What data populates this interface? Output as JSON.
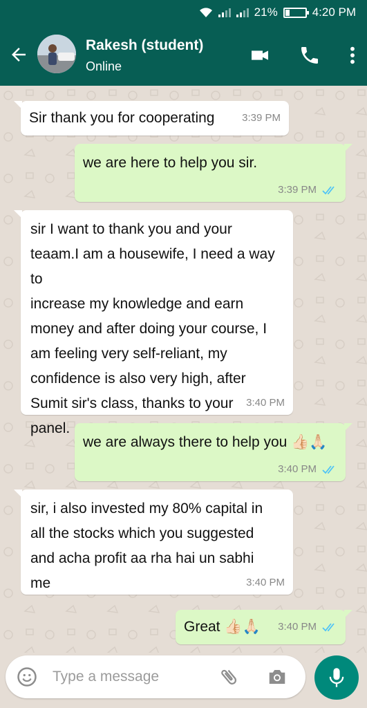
{
  "status_bar": {
    "battery_text": "21%",
    "battery_level": 0.21,
    "time": "4:20 PM"
  },
  "header": {
    "contact_name": "Rakesh (student)",
    "contact_status": "Online",
    "icons": [
      "back-arrow-icon",
      "video-call-icon",
      "phone-icon",
      "more-vert-icon"
    ]
  },
  "messages": [
    {
      "direction": "incoming",
      "text": "Sir thank you for cooperating",
      "time": "3:39 PM"
    },
    {
      "direction": "outgoing",
      "text": "we are here to help you sir.",
      "time": "3:39 PM",
      "status": "read"
    },
    {
      "direction": "incoming",
      "text": "sir I want to thank you and your\nteaam.I am a housewife, I need a way to\nincrease my knowledge and earn\nmoney and after doing your course, I\nam feeling very self-reliant, my\nconfidence is also very high, after\nSumit sir's class, thanks to your\npanel.",
      "time": "3:40 PM"
    },
    {
      "direction": "outgoing",
      "text": "we are always there to help you 👍🏻🙏🏻",
      "time": "3:40 PM",
      "status": "read"
    },
    {
      "direction": "incoming",
      "text": "sir, i also invested my 80% capital in\nall the stocks which you suggested\nand acha profit aa rha hai un sabhi\nme",
      "time": "3:40 PM"
    },
    {
      "direction": "outgoing",
      "text": "Great 👍🏻🙏🏻",
      "time": "3:40 PM",
      "status": "read"
    }
  ],
  "composer": {
    "placeholder": "Type a message",
    "icons": [
      "emoji-icon",
      "attachment-icon",
      "camera-icon",
      "mic-icon"
    ]
  },
  "colors": {
    "header": "#075e54",
    "outgoing_bubble": "#dcf8c6",
    "incoming_bubble": "#ffffff",
    "background": "#e5ddd5",
    "read_ticks": "#4fc3f7",
    "mic_button": "#00897b"
  }
}
